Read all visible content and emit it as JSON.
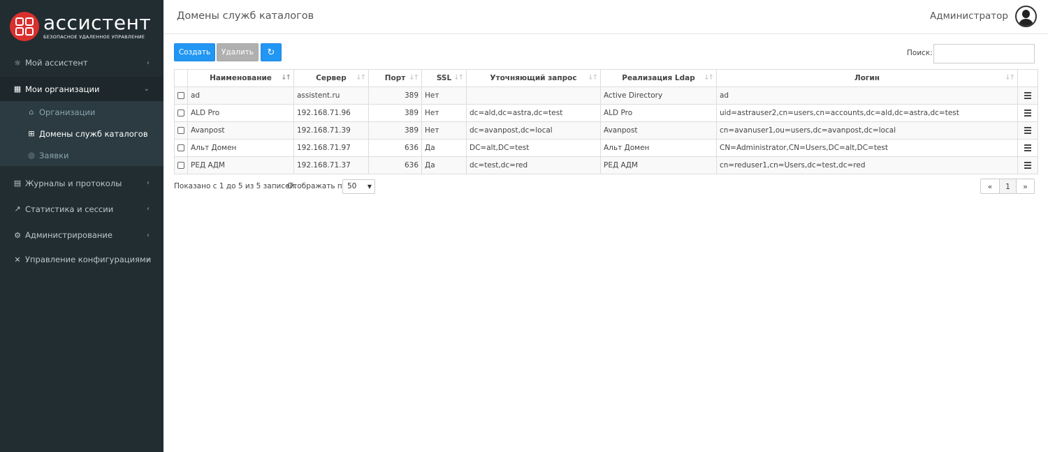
{
  "brand": {
    "title": "ассистент",
    "subtitle": "БЕЗОПАСНОЕ УДАЛЕННОЕ УПРАВЛЕНИЕ"
  },
  "sidebar": {
    "items": [
      {
        "label": "Мой ассистент",
        "icon": "sun-icon"
      },
      {
        "label": "Мои организации",
        "icon": "building-icon",
        "expanded": true
      },
      {
        "label": "Журналы и протоколы",
        "icon": "book-icon"
      },
      {
        "label": "Статистика и сессии",
        "icon": "line-chart-icon"
      },
      {
        "label": "Администрирование",
        "icon": "cogs-icon"
      },
      {
        "label": "Управление конфигурациями",
        "icon": "wrench-icon"
      }
    ],
    "sub_items": [
      {
        "label": "Организации",
        "icon": "institution-icon"
      },
      {
        "label": "Домены служб каталогов",
        "icon": "sitemap-icon",
        "current": true
      },
      {
        "label": "Заявки",
        "icon": "support-icon"
      }
    ]
  },
  "header": {
    "title": "Домены служб каталогов",
    "user": "Администратор"
  },
  "toolbar": {
    "create": "Создать",
    "delete": "Удалить",
    "refresh_icon": "refresh-icon",
    "search_label": "Поиск:",
    "search_value": ""
  },
  "table": {
    "columns": [
      "Наименование",
      "Сервер",
      "Порт",
      "SSL",
      "Уточняющий запрос",
      "Реализация Ldap",
      "Логин"
    ],
    "rows": [
      {
        "name": "ad",
        "server": "assistent.ru",
        "port": "389",
        "ssl": "Нет",
        "filter": "",
        "impl": "Active Directory",
        "login": "ad"
      },
      {
        "name": "ALD Pro",
        "server": "192.168.71.96",
        "port": "389",
        "ssl": "Нет",
        "filter": "dc=ald,dc=astra,dc=test",
        "impl": "ALD Pro",
        "login": "uid=astrauser2,cn=users,cn=accounts,dc=ald,dc=astra,dc=test"
      },
      {
        "name": "Avanpost",
        "server": "192.168.71.39",
        "port": "389",
        "ssl": "Нет",
        "filter": "dc=avanpost,dc=local",
        "impl": "Avanpost",
        "login": "cn=avanuser1,ou=users,dc=avanpost,dc=local"
      },
      {
        "name": "Альт Домен",
        "server": "192.168.71.97",
        "port": "636",
        "ssl": "Да",
        "filter": "DC=alt,DC=test",
        "impl": "Альт Домен",
        "login": "CN=Administrator,CN=Users,DC=alt,DC=test"
      },
      {
        "name": "РЕД АДМ",
        "server": "192.168.71.37",
        "port": "636",
        "ssl": "Да",
        "filter": "dc=test,dc=red",
        "impl": "РЕД АДМ",
        "login": "cn=reduser1,cn=Users,dc=test,dc=red"
      }
    ]
  },
  "footer": {
    "info": "Показано с 1 до 5 из 5 записей.",
    "per_page_label": "Отображать по",
    "per_page_value": "50",
    "page": "1",
    "first": "«",
    "last": "»"
  }
}
